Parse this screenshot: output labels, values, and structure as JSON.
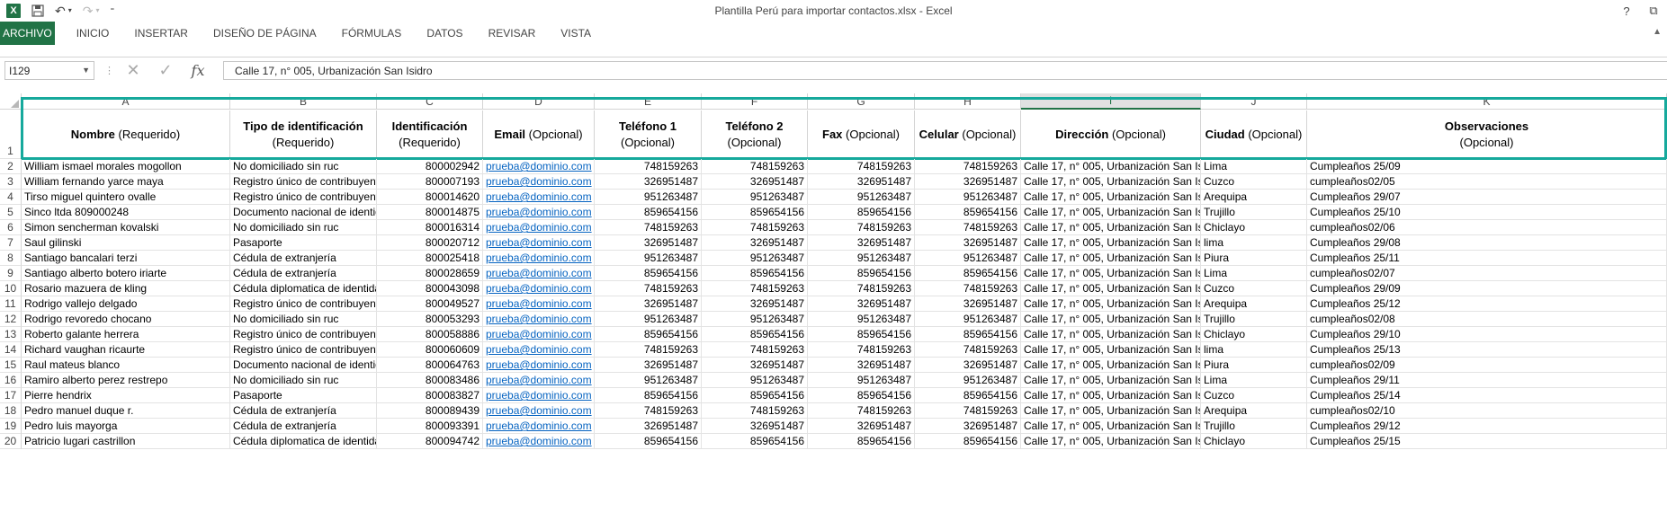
{
  "titlebar": {
    "title": "Plantilla Perú para importar contactos.xlsx - Excel",
    "help": "?",
    "restore": "⧉"
  },
  "ribbon": {
    "tabs": [
      {
        "label": "ARCHIVO",
        "active": true
      },
      {
        "label": "INICIO"
      },
      {
        "label": "INSERTAR"
      },
      {
        "label": "DISEÑO DE PÁGINA"
      },
      {
        "label": "FÓRMULAS"
      },
      {
        "label": "DATOS"
      },
      {
        "label": "REVISAR"
      },
      {
        "label": "VISTA"
      }
    ]
  },
  "formula_bar": {
    "name_box": "I129",
    "fx": "fx",
    "value": "Calle 17, n° 005, Urbanización San Isidro"
  },
  "columns": [
    "A",
    "B",
    "C",
    "D",
    "E",
    "F",
    "G",
    "H",
    "I",
    "J",
    "K"
  ],
  "selected_column": "I",
  "header_row": {
    "row_number": "1",
    "cells": [
      {
        "bold": "Nombre",
        "rest": " (Requerido)"
      },
      {
        "bold": "Tipo de identificación",
        "rest": "(Requerido)"
      },
      {
        "bold": "Identificación",
        "rest": "(Requerido)"
      },
      {
        "bold": "Email",
        "rest": " (Opcional)"
      },
      {
        "bold": "Teléfono 1",
        "rest": "(Opcional)"
      },
      {
        "bold": "Teléfono 2",
        "rest": "(Opcional)"
      },
      {
        "bold": "Fax",
        "rest": " (Opcional)"
      },
      {
        "bold": "Celular",
        "rest": " (Opcional)"
      },
      {
        "bold": "Dirección",
        "rest": " (Opcional)"
      },
      {
        "bold": "Ciudad",
        "rest": " (Opcional)"
      },
      {
        "bold": "Observaciones",
        "rest": "(Opcional)"
      }
    ]
  },
  "rows": [
    [
      "2",
      "William ismael morales mogollon",
      "No domiciliado sin ruc",
      "800002942",
      "prueba@dominio.com",
      "748159263",
      "748159263",
      "748159263",
      "748159263",
      "Calle 17, n° 005, Urbanización San Isidro",
      "Lima",
      "Cumpleaños 25/09"
    ],
    [
      "3",
      "William fernando yarce maya",
      "Registro único de contribuyente",
      "800007193",
      "prueba@dominio.com",
      "326951487",
      "326951487",
      "326951487",
      "326951487",
      "Calle 17, n° 005, Urbanización San Isidro",
      "Cuzco",
      "cumpleaños02/05"
    ],
    [
      "4",
      "Tirso miguel quintero ovalle",
      "Registro único de contribuyente",
      "800014620",
      "prueba@dominio.com",
      "951263487",
      "951263487",
      "951263487",
      "951263487",
      "Calle 17, n° 005, Urbanización San Isidro",
      "Arequipa",
      "Cumpleaños 29/07"
    ],
    [
      "5",
      "Sinco ltda 809000248",
      "Documento nacional de identidad",
      "800014875",
      "prueba@dominio.com",
      "859654156",
      "859654156",
      "859654156",
      "859654156",
      "Calle 17, n° 005, Urbanización San Isidro",
      "Trujillo",
      "Cumpleaños 25/10"
    ],
    [
      "6",
      "Simon sencherman kovalski",
      "No domiciliado sin ruc",
      "800016314",
      "prueba@dominio.com",
      "748159263",
      "748159263",
      "748159263",
      "748159263",
      "Calle 17, n° 005, Urbanización San Isidro",
      "Chiclayo",
      "cumpleaños02/06"
    ],
    [
      "7",
      "Saul gilinski",
      "Pasaporte",
      "800020712",
      "prueba@dominio.com",
      "326951487",
      "326951487",
      "326951487",
      "326951487",
      "Calle 17, n° 005, Urbanización San Isidro",
      "lima",
      "Cumpleaños 29/08"
    ],
    [
      "8",
      "Santiago bancalari terzi",
      "Cédula de extranjería",
      "800025418",
      "prueba@dominio.com",
      "951263487",
      "951263487",
      "951263487",
      "951263487",
      "Calle 17, n° 005, Urbanización San Isidro",
      "Piura",
      "Cumpleaños 25/11"
    ],
    [
      "9",
      "Santiago alberto botero iriarte",
      "Cédula de extranjería",
      "800028659",
      "prueba@dominio.com",
      "859654156",
      "859654156",
      "859654156",
      "859654156",
      "Calle 17, n° 005, Urbanización San Isidro",
      "Lima",
      "cumpleaños02/07"
    ],
    [
      "10",
      "Rosario mazuera de kling",
      "Cédula diplomatica de identidad",
      "800043098",
      "prueba@dominio.com",
      "748159263",
      "748159263",
      "748159263",
      "748159263",
      "Calle 17, n° 005, Urbanización San Isidro",
      "Cuzco",
      "Cumpleaños 29/09"
    ],
    [
      "11",
      "Rodrigo vallejo delgado",
      "Registro único de contribuyente",
      "800049527",
      "prueba@dominio.com",
      "326951487",
      "326951487",
      "326951487",
      "326951487",
      "Calle 17, n° 005, Urbanización San Isidro",
      "Arequipa",
      "Cumpleaños 25/12"
    ],
    [
      "12",
      "Rodrigo revoredo chocano",
      "No domiciliado sin ruc",
      "800053293",
      "prueba@dominio.com",
      "951263487",
      "951263487",
      "951263487",
      "951263487",
      "Calle 17, n° 005, Urbanización San Isidro",
      "Trujillo",
      "cumpleaños02/08"
    ],
    [
      "13",
      "Roberto galante herrera",
      "Registro único de contribuyente",
      "800058886",
      "prueba@dominio.com",
      "859654156",
      "859654156",
      "859654156",
      "859654156",
      "Calle 17, n° 005, Urbanización San Isidro",
      "Chiclayo",
      "Cumpleaños 29/10"
    ],
    [
      "14",
      "Richard vaughan ricaurte",
      "Registro único de contribuyente",
      "800060609",
      "prueba@dominio.com",
      "748159263",
      "748159263",
      "748159263",
      "748159263",
      "Calle 17, n° 005, Urbanización San Isidro",
      "lima",
      "Cumpleaños 25/13"
    ],
    [
      "15",
      "Raul mateus blanco",
      "Documento nacional de identidad",
      "800064763",
      "prueba@dominio.com",
      "326951487",
      "326951487",
      "326951487",
      "326951487",
      "Calle 17, n° 005, Urbanización San Isidro",
      "Piura",
      "cumpleaños02/09"
    ],
    [
      "16",
      "Ramiro alberto perez restrepo",
      "No domiciliado sin ruc",
      "800083486",
      "prueba@dominio.com",
      "951263487",
      "951263487",
      "951263487",
      "951263487",
      "Calle 17, n° 005, Urbanización San Isidro",
      "Lima",
      "Cumpleaños 29/11"
    ],
    [
      "17",
      "Pierre hendrix",
      "Pasaporte",
      "800083827",
      "prueba@dominio.com",
      "859654156",
      "859654156",
      "859654156",
      "859654156",
      "Calle 17, n° 005, Urbanización San Isidro",
      "Cuzco",
      "Cumpleaños 25/14"
    ],
    [
      "18",
      "Pedro manuel duque r.",
      "Cédula de extranjería",
      "800089439",
      "prueba@dominio.com",
      "748159263",
      "748159263",
      "748159263",
      "748159263",
      "Calle 17, n° 005, Urbanización San Isidro",
      "Arequipa",
      "cumpleaños02/10"
    ],
    [
      "19",
      "Pedro luis mayorga",
      "Cédula de extranjería",
      "800093391",
      "prueba@dominio.com",
      "326951487",
      "326951487",
      "326951487",
      "326951487",
      "Calle 17, n° 005, Urbanización San Isidro",
      "Trujillo",
      "Cumpleaños 29/12"
    ],
    [
      "20",
      "Patricio lugari castrillon",
      "Cédula diplomatica de identidad",
      "800094742",
      "prueba@dominio.com",
      "859654156",
      "859654156",
      "859654156",
      "859654156",
      "Calle 17, n° 005, Urbanización San Isidro",
      "Chiclayo",
      "Cumpleaños 25/15"
    ]
  ]
}
